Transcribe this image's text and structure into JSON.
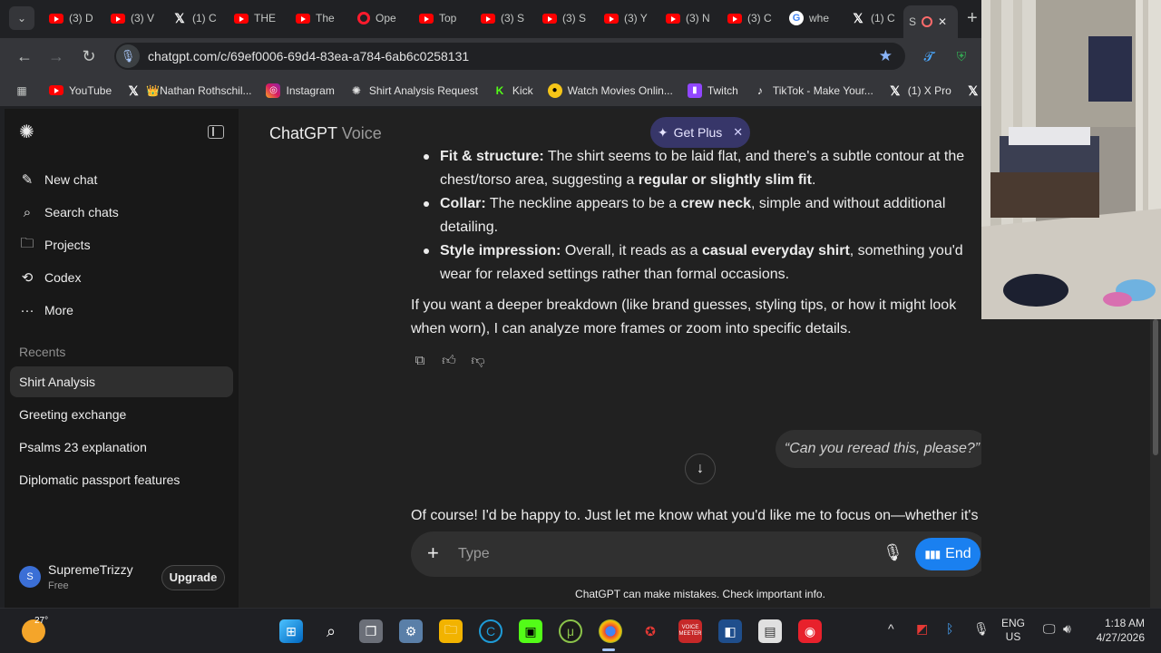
{
  "browser": {
    "tabs": [
      {
        "icon": "youtube-icon",
        "title": "(3) D"
      },
      {
        "icon": "youtube-icon",
        "title": "(3) V"
      },
      {
        "icon": "x-icon",
        "title": "(1) C"
      },
      {
        "icon": "youtube-icon",
        "title": "THE"
      },
      {
        "icon": "youtube-icon",
        "title": "The"
      },
      {
        "icon": "youtube-icon",
        "title": "Ope"
      },
      {
        "icon": "youtube-icon",
        "title": "Top"
      },
      {
        "icon": "youtube-icon",
        "title": "(3) S"
      },
      {
        "icon": "youtube-icon",
        "title": "(3) S"
      },
      {
        "icon": "youtube-icon",
        "title": "(3) Y"
      },
      {
        "icon": "youtube-icon",
        "title": "(3) N"
      },
      {
        "icon": "youtube-icon",
        "title": "(3) C"
      },
      {
        "icon": "google-icon",
        "title": "whe"
      },
      {
        "icon": "x-icon",
        "title": "(1) C"
      },
      {
        "icon": "openai-icon",
        "title": "S",
        "active": true
      }
    ],
    "url": "chatgpt.com/c/69ef0006-69d4-83ea-a784-6ab6c0258131",
    "bookmarks": [
      {
        "icon": "youtube-icon",
        "label": "YouTube"
      },
      {
        "icon": "x-icon",
        "label": "👑Nathan Rothschil..."
      },
      {
        "icon": "instagram-icon",
        "label": "Instagram"
      },
      {
        "icon": "openai-icon",
        "label": "Shirt Analysis Request"
      },
      {
        "icon": "kick-icon",
        "label": "Kick"
      },
      {
        "icon": "movies-icon",
        "label": "Watch Movies Onlin..."
      },
      {
        "icon": "twitch-icon",
        "label": "Twitch"
      },
      {
        "icon": "tiktok-icon",
        "label": "TikTok - Make Your..."
      },
      {
        "icon": "x-icon",
        "label": "(1) X Pro"
      }
    ]
  },
  "sidebar": {
    "nav": [
      {
        "icon": "edit-icon",
        "label": "New chat"
      },
      {
        "icon": "search-icon",
        "label": "Search chats"
      },
      {
        "icon": "folder-icon",
        "label": "Projects"
      },
      {
        "icon": "codex-icon",
        "label": "Codex"
      },
      {
        "icon": "more-icon",
        "label": "More"
      }
    ],
    "recents_heading": "Recents",
    "chats": [
      {
        "label": "Shirt Analysis",
        "active": true
      },
      {
        "label": "Greeting exchange"
      },
      {
        "label": "Psalms 23 explanation"
      },
      {
        "label": "Diplomatic passport features"
      }
    ],
    "user": {
      "initial": "S",
      "name": "SupremeTrizzy",
      "plan": "Free",
      "upgrade_label": "Upgrade"
    }
  },
  "main": {
    "title": "ChatGPT",
    "title_sub": "Voice",
    "get_plus_label": "Get Plus",
    "bullets": [
      {
        "bold": "Fit & structure:",
        "text": " The shirt seems to be laid flat, and there's a subtle contour at the chest/torso area, suggesting a ",
        "bold2": "regular or slightly slim fit",
        "tail": "."
      },
      {
        "bold": "Collar:",
        "text": " The neckline appears to be a ",
        "bold2": "crew neck",
        "tail": ", simple and without additional detailing."
      },
      {
        "bold": "Style impression:",
        "text": " Overall, it reads as a ",
        "bold2": "casual everyday shirt",
        "tail": ", something you'd wear for relaxed settings rather than formal occasions."
      }
    ],
    "followup": "If you want a deeper breakdown (like brand guesses, styling tips, or how it might look when worn), I can analyze more frames or zoom into specific details.",
    "user_message": "“Can you reread this, please?”",
    "reply": "Of course! I'd be happy to. Just let me know what you'd like me to focus on—whether it's",
    "composer_placeholder": "Type",
    "end_label": "End",
    "disclaimer": "ChatGPT can make mistakes. Check important info."
  },
  "taskbar": {
    "temperature": "27°",
    "lang_top": "ENG",
    "lang_bottom": "US",
    "time": "1:18 AM",
    "date": "4/27/2026"
  },
  "colors": {
    "accent": "#1a80f0",
    "plus_bg": "#373669",
    "sidebar_bg": "#181818",
    "main_bg": "#212121"
  }
}
